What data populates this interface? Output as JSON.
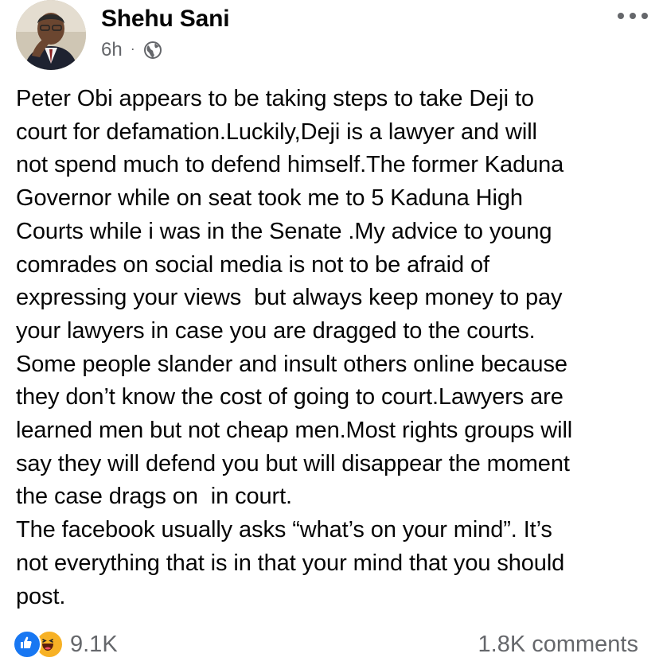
{
  "post": {
    "author": "Shehu Sani",
    "time": "6h",
    "separator": "·",
    "privacy_icon": "globe-icon",
    "body": "Peter Obi appears to be taking steps to take Deji to\ncourt for defamation.Luckily,Deji is a lawyer and will\nnot spend much to defend himself.The former Kaduna\nGovernor while on seat took me to 5 Kaduna High\nCourts while i was in the Senate .My advice to young\ncomrades on social media is not to be afraid of\nexpressing your views  but always keep money to pay\nyour lawyers in case you are dragged to the courts.\nSome people slander and insult others online because\nthey don’t know the cost of going to court.Lawyers are\nlearned men but not cheap men.Most rights groups will\nsay they will defend you but will disappear the moment\nthe case drags on  in court.\nThe facebook usually asks “what’s on your mind”. It’s\nnot everything that is in that your mind that you should\npost."
  },
  "footer": {
    "reaction_icons": [
      "like-icon",
      "haha-icon"
    ],
    "reaction_count": "9.1K",
    "comments": "1.8K comments"
  },
  "colors": {
    "text": "#050505",
    "secondary": "#65676b",
    "like_blue": "#1877f2",
    "haha_yellow": "#f7b125"
  }
}
